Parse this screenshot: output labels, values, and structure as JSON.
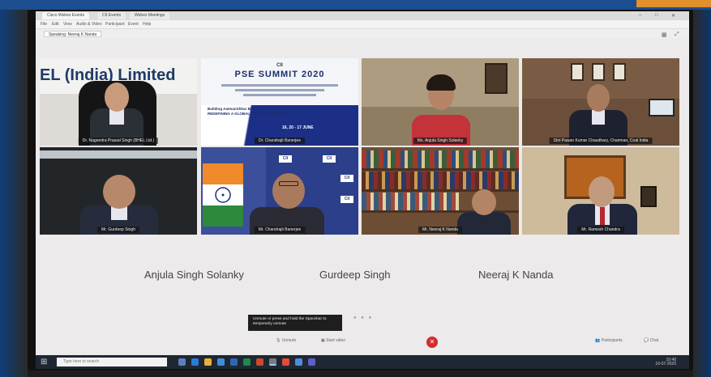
{
  "browser": {
    "tabs": [
      "Cisco Webex Events",
      "CII Events",
      "Webex Meetings"
    ],
    "menu": [
      "File",
      "Edit",
      "View",
      "Audio & Video",
      "Participant",
      "Event",
      "Help"
    ],
    "speaking_label": "Speaking: Neeraj K Nanda"
  },
  "tiles": [
    {
      "name": "Dr. Nagendra Prasad Singh (BHEL Ltd.)",
      "banner": "EL (India) Limited"
    },
    {
      "name": "Dr. Chandrajit Banerjee",
      "logo": "CII",
      "title": "PSE SUMMIT 2020",
      "theme_line1": "Building Aatmanirbhar Bharat",
      "theme_line2": "REDEFINING A GLOBAL STRATEGY FOR PSUs",
      "dates": "16, 20 - 17 JUNE"
    },
    {
      "name": "Ms. Anjula Singh Solanky"
    },
    {
      "name": "Shri Pawan Kumar Chaudhary, Chairman, Coal India"
    },
    {
      "name": "Mr. Gurdeep Singh"
    },
    {
      "name": "Mr. Chandrajit Banerjee",
      "logo": "CII"
    },
    {
      "name": "Mr. Neeraj K Nanda"
    },
    {
      "name": "Mr. Ramesh Chandra"
    }
  ],
  "participants": [
    "Anjula Singh Solanky",
    "Gurdeep Singh",
    "Neeraj K Nanda"
  ],
  "tooltip": "Unmute or press and hold the Spacebar to temporarily unmute",
  "controls": {
    "mute_label": "Unmute",
    "video_label": "Start video",
    "participants_label": "Participants",
    "chat_label": "Chat"
  },
  "taskbar": {
    "search_placeholder": "Type here to search",
    "time": "10:48",
    "date": "16-07-2020"
  },
  "colors": {
    "leave_button": "#d52b2b",
    "brand_blue": "#1c4d8f",
    "taskbar": "#1f2733"
  }
}
